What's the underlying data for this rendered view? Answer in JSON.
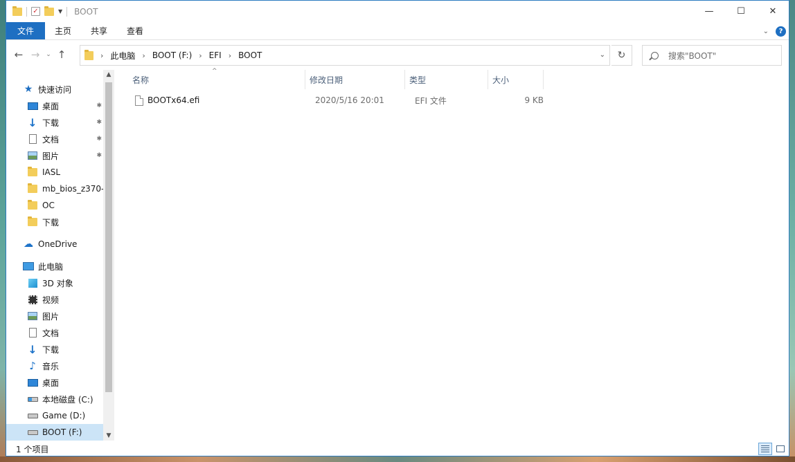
{
  "window": {
    "title": "BOOT",
    "controls": {
      "minimize": "—",
      "maximize": "☐",
      "close": "✕"
    }
  },
  "ribbon": {
    "tabs": [
      "文件",
      "主页",
      "共享",
      "查看"
    ],
    "expand": "⌄",
    "help": "?"
  },
  "address": {
    "crumbs": [
      "此电脑",
      "BOOT (F:)",
      "EFI",
      "BOOT"
    ],
    "separator": "›",
    "dropdown": "⌄",
    "refresh": "↻"
  },
  "search": {
    "placeholder": "搜索\"BOOT\""
  },
  "nav_buttons": {
    "back": "←",
    "forward": "→",
    "recent": "⌄",
    "up": "↑"
  },
  "sidebar": {
    "quick_access": {
      "label": "快速访问",
      "items": [
        {
          "label": "桌面",
          "pinned": true
        },
        {
          "label": "下载",
          "pinned": true
        },
        {
          "label": "文档",
          "pinned": true
        },
        {
          "label": "图片",
          "pinned": true
        },
        {
          "label": "IASL"
        },
        {
          "label": "mb_bios_z370-"
        },
        {
          "label": "OC"
        },
        {
          "label": "下载"
        }
      ]
    },
    "onedrive": {
      "label": "OneDrive"
    },
    "this_pc": {
      "label": "此电脑",
      "items": [
        {
          "label": "3D 对象"
        },
        {
          "label": "视频"
        },
        {
          "label": "图片"
        },
        {
          "label": "文档"
        },
        {
          "label": "下载"
        },
        {
          "label": "音乐"
        },
        {
          "label": "桌面"
        },
        {
          "label": "本地磁盘 (C:)"
        },
        {
          "label": "Game (D:)"
        },
        {
          "label": "BOOT (F:)"
        }
      ]
    },
    "pin_glyph": "📌"
  },
  "columns": {
    "name": "名称",
    "modified": "修改日期",
    "type": "类型",
    "size": "大小"
  },
  "files": [
    {
      "name": "BOOTx64.efi",
      "modified": "2020/5/16 20:01",
      "type": "EFI 文件",
      "size": "9 KB"
    }
  ],
  "status": {
    "count": "1 个项目"
  },
  "colors": {
    "accent": "#1e6fc2",
    "selection": "#cce4f7"
  }
}
